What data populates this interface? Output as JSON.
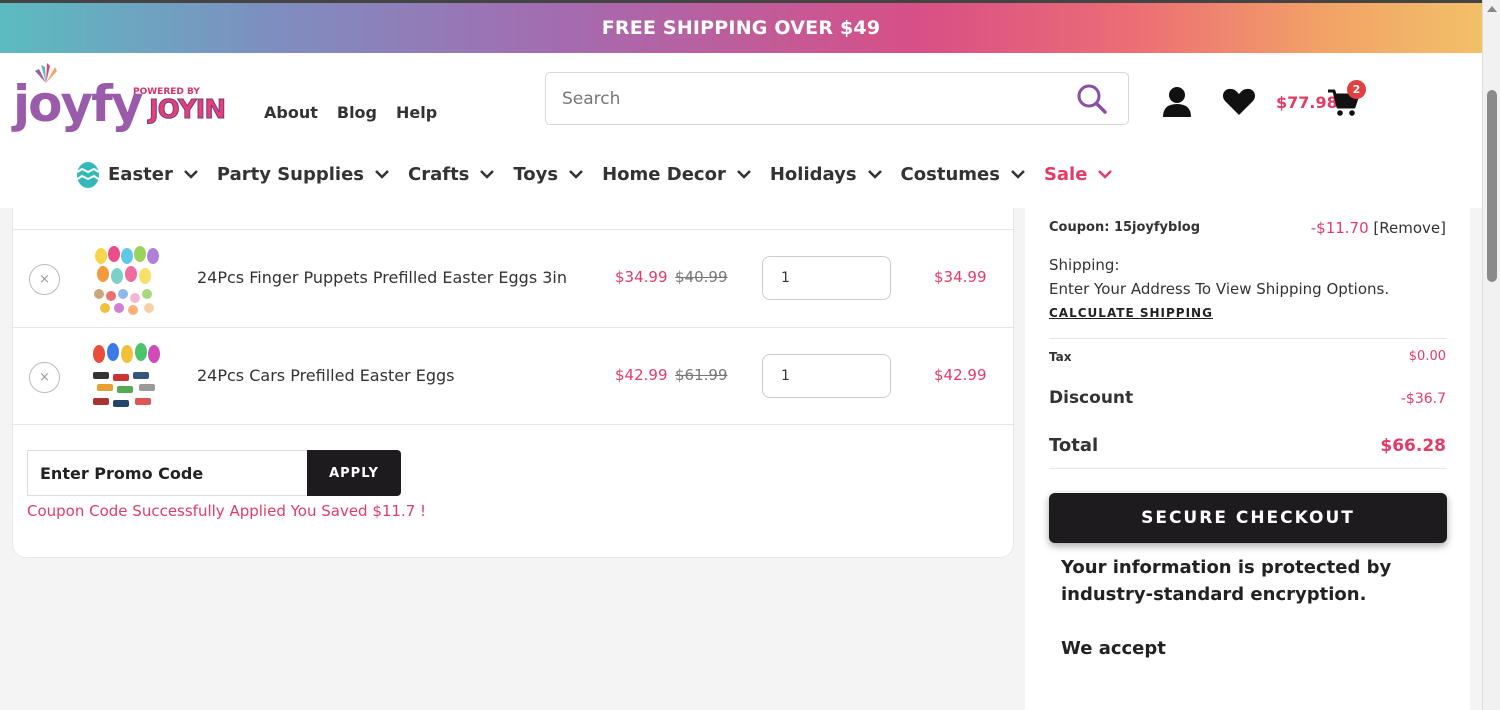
{
  "banner": {
    "text": "FREE SHIPPING OVER $49"
  },
  "header": {
    "logo_text": "joyfy",
    "logo_powered": "POWERED BY",
    "logo_joyin": "JOYIN",
    "links": [
      "About",
      "Blog",
      "Help"
    ],
    "search_placeholder": "Search",
    "cart_total": "$77.98",
    "cart_count": "2"
  },
  "nav": {
    "items": [
      "Easter",
      "Party Supplies",
      "Crafts",
      "Toys",
      "Home Decor",
      "Holidays",
      "Costumes",
      "Sale"
    ]
  },
  "cart": {
    "items": [
      {
        "name": "24Pcs Finger Puppets Prefilled Easter Eggs 3in",
        "price": "$34.99",
        "original_price": "$40.99",
        "quantity": "1",
        "subtotal": "$34.99",
        "remove": "×"
      },
      {
        "name": "24Pcs Cars Prefilled Easter Eggs",
        "price": "$42.99",
        "original_price": "$61.99",
        "quantity": "1",
        "subtotal": "$42.99",
        "remove": "×"
      }
    ],
    "promo_placeholder": "Enter Promo Code",
    "apply_label": "APPLY",
    "promo_message": "Coupon Code Successfully Applied You Saved $11.7 !"
  },
  "summary": {
    "coupon_label": "Coupon: 15joyfyblog",
    "coupon_value": "-$11.70",
    "coupon_remove": "[Remove]",
    "shipping_label": "Shipping:",
    "shipping_note": "Enter Your Address To View Shipping Options.",
    "calculate_shipping": "CALCULATE SHIPPING",
    "tax_label": "Tax",
    "tax_value": "$0.00",
    "discount_label": "Discount",
    "discount_value": "-$36.7",
    "total_label": "Total",
    "total_value": "$66.28",
    "checkout_label": "SECURE CHECKOUT",
    "secure_note": "Your information is protected by industry-standard encryption.",
    "we_accept": "We accept"
  },
  "colors": {
    "accent": "#e33b66",
    "dark": "#1e1b1e",
    "logo_purple": "#9a5bab"
  }
}
